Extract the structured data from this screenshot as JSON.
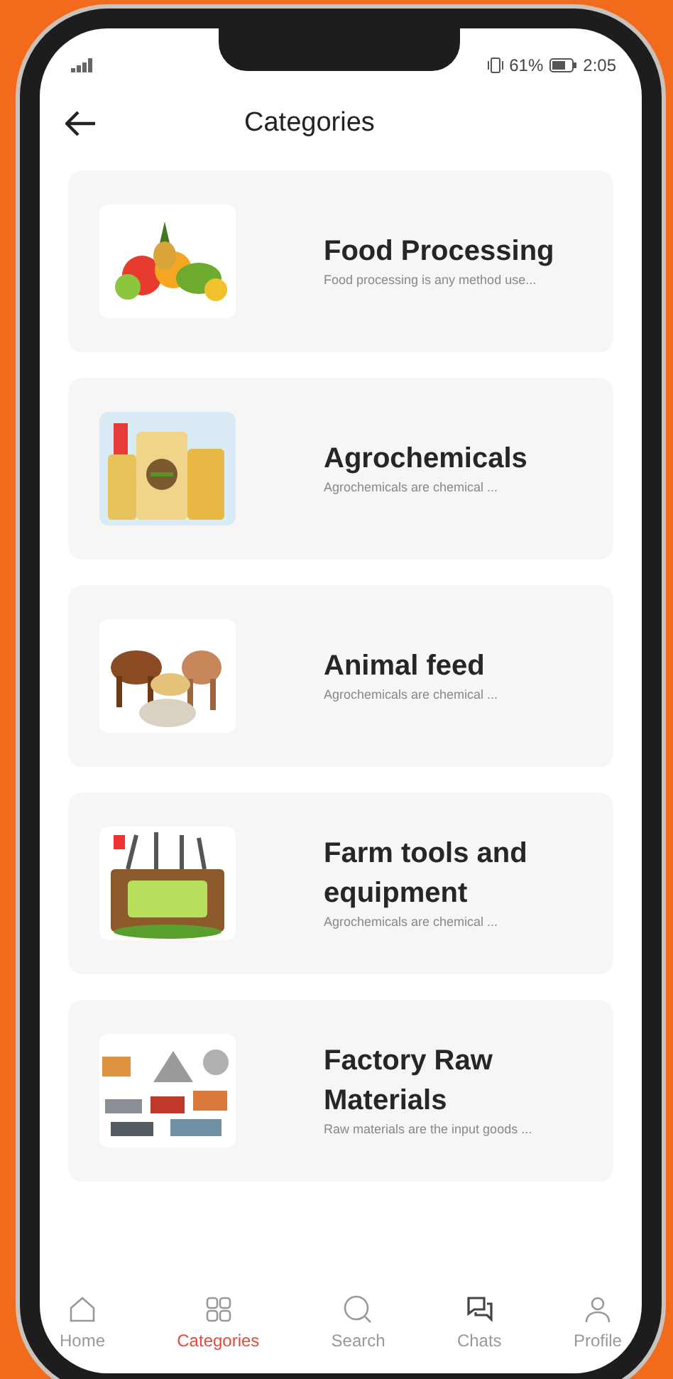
{
  "status_bar": {
    "battery": "61%",
    "time": "2:05"
  },
  "header": {
    "title": "Categories"
  },
  "categories": [
    {
      "title": "Food Processing",
      "description": "Food processing is any method use...",
      "kind": "picture"
    },
    {
      "title": "Agrochemicals",
      "description": "Agrochemicals are chemical ...",
      "kind": "picture"
    },
    {
      "title": "Animal feed",
      "description": "Agrochemicals are chemical ...",
      "kind": "picture"
    },
    {
      "title": "Farm tools and equipment",
      "description": "Agrochemicals are chemical ...",
      "kind": "picture"
    },
    {
      "title": "Factory Raw Materials",
      "description": "Raw materials are the input goods ...",
      "kind": "picture"
    }
  ],
  "bottom_nav": [
    {
      "label": "Home",
      "selected": false
    },
    {
      "label": "Categories",
      "selected": true
    },
    {
      "label": "Search",
      "selected": false
    },
    {
      "label": "Chats",
      "selected": false
    },
    {
      "label": "Profile",
      "selected": false
    }
  ]
}
